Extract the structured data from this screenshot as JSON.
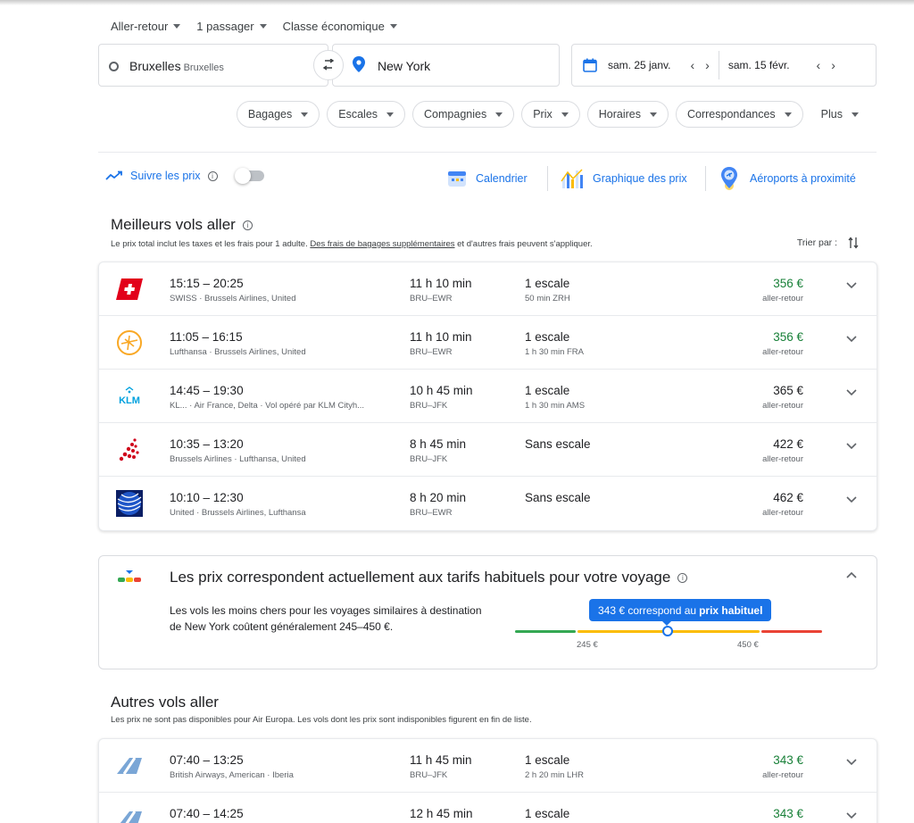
{
  "trip_options": [
    {
      "label": "Aller-retour"
    },
    {
      "label": "1 passager"
    },
    {
      "label": "Classe économique"
    }
  ],
  "search": {
    "from_city": "Bruxelles",
    "from_sub": "Bruxelles",
    "to_city": "New York",
    "depart_date": "sam. 25 janv.",
    "return_date": "sam. 15 févr."
  },
  "filters": [
    "Bagages",
    "Escales",
    "Compagnies",
    "Prix",
    "Horaires",
    "Correspondances",
    "Plus"
  ],
  "tools": {
    "track_label": "Suivre les prix",
    "calendar_label": "Calendrier",
    "price_graph_label": "Graphique des prix",
    "nearby_label": "Aéroports à proximité"
  },
  "best": {
    "title": "Meilleurs vols aller",
    "subtitle_pre": "Le prix total inclut les taxes et les frais pour 1 adulte. ",
    "subtitle_link": "Des frais de bagages supplémentaires",
    "subtitle_post": " et d'autres frais peuvent s'appliquer.",
    "sort_label": "Trier par :",
    "flights": [
      {
        "logo": "swiss-logo",
        "times": "15:15 – 20:25",
        "airlines": "SWISS  ·  Brussels Airlines, United",
        "duration": "11 h 10 min",
        "route": "BRU–EWR",
        "stops": "1 escale",
        "stop_info": "50 min ZRH",
        "price": "356 €",
        "price_color": "green",
        "price_type": "aller-retour"
      },
      {
        "logo": "lufthansa-logo",
        "times": "11:05 – 16:15",
        "airlines": "Lufthansa  ·  Brussels Airlines, United",
        "duration": "11 h 10 min",
        "route": "BRU–EWR",
        "stops": "1 escale",
        "stop_info": "1 h 30 min FRA",
        "price": "356 €",
        "price_color": "green",
        "price_type": "aller-retour"
      },
      {
        "logo": "klm-logo",
        "times": "14:45 – 19:30",
        "airlines": "KL...  ·  Air France, Delta  ·  Vol opéré par KLM Cityh...",
        "duration": "10 h 45 min",
        "route": "BRU–JFK",
        "stops": "1 escale",
        "stop_info": "1 h 30 min AMS",
        "price": "365 €",
        "price_color": "black",
        "price_type": "aller-retour"
      },
      {
        "logo": "brussels-airlines-logo",
        "times": "10:35 – 13:20",
        "airlines": "Brussels Airlines  ·  Lufthansa, United",
        "duration": "8 h 45 min",
        "route": "BRU–JFK",
        "stops": "Sans escale",
        "stop_info": "",
        "price": "422 €",
        "price_color": "black",
        "price_type": "aller-retour"
      },
      {
        "logo": "united-logo",
        "times": "10:10 – 12:30",
        "airlines": "United  ·  Brussels Airlines, Lufthansa",
        "duration": "8 h 20 min",
        "route": "BRU–EWR",
        "stops": "Sans escale",
        "stop_info": "",
        "price": "462 €",
        "price_color": "black",
        "price_type": "aller-retour"
      }
    ]
  },
  "insight": {
    "title": "Les prix correspondent actuellement aux tarifs habituels pour votre voyage",
    "text": "Les vols les moins chers pour les voyages similaires à destination de New York coûtent généralement 245–450 €.",
    "tip_pre": "343 € correspond au ",
    "tip_bold": "prix habituel",
    "low_tick": "245 €",
    "high_tick": "450 €",
    "colors": {
      "low": "#34a853",
      "typical": "#fbbc04",
      "high": "#ea4335"
    }
  },
  "other": {
    "title": "Autres vols aller",
    "subtitle": "Les prix ne sont pas disponibles pour Air Europa. Les vols dont les prix sont indisponibles figurent en fin de liste.",
    "flights": [
      {
        "logo": "british-airways-logo",
        "times": "07:40 – 13:25",
        "airlines": "British Airways, American  ·  Iberia",
        "duration": "11 h 45 min",
        "route": "BRU–JFK",
        "stops": "1 escale",
        "stop_info": "2 h 20 min LHR",
        "price": "343 €",
        "price_color": "green",
        "price_type": "aller-retour"
      },
      {
        "logo": "british-airways-logo",
        "times": "07:40 – 14:25",
        "airlines": "",
        "duration": "12 h 45 min",
        "route": "",
        "stops": "1 escale",
        "stop_info": "",
        "price": "343 €",
        "price_color": "green",
        "price_type": ""
      }
    ]
  },
  "accent": "#1a73e8"
}
